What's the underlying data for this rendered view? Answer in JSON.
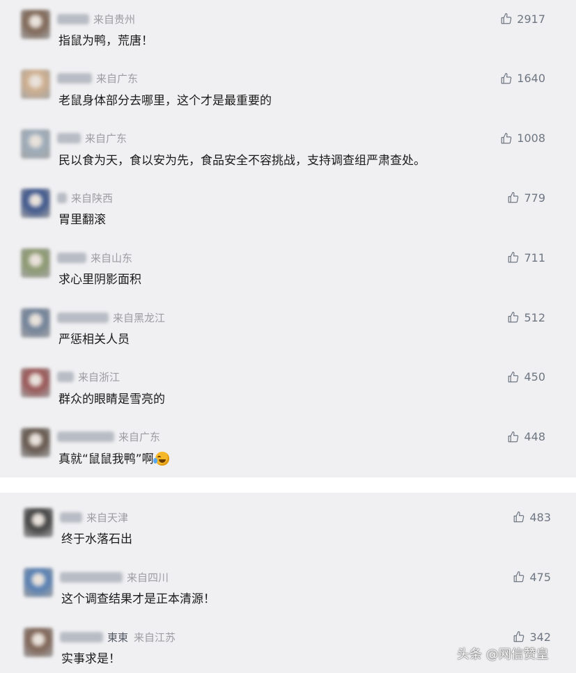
{
  "comments_top": [
    {
      "name_clear": "",
      "location": "来自贵州",
      "text": "指鼠为鸭，荒唐！",
      "likes": "2917",
      "avatar_color": "#6b4e3a"
    },
    {
      "name_clear": "",
      "location": "来自广东",
      "text": "老鼠身体部分去哪里，这个才是最重要的",
      "likes": "1640",
      "avatar_color": "#c9a47e"
    },
    {
      "name_clear": "",
      "location": "来自广东",
      "text": "民以食为天，食以安为先，食品安全不容挑战，支持调查组严肃查处。",
      "likes": "1008",
      "avatar_color": "#8fa0b0"
    },
    {
      "name_clear": "",
      "location": "来自陕西",
      "text": "胃里翻滚",
      "likes": "779",
      "avatar_color": "#1d3a7a"
    },
    {
      "name_clear": "",
      "location": "来自山东",
      "text": "求心里阴影面积",
      "likes": "711",
      "avatar_color": "#7a8a5a"
    },
    {
      "name_clear": "",
      "location": "来自黑龙江",
      "text": "严惩相关人员",
      "likes": "512",
      "avatar_color": "#5a6e8a"
    },
    {
      "name_clear": "",
      "location": "来自浙江",
      "text": "群众的眼睛是雪亮的",
      "likes": "450",
      "avatar_color": "#8a3a3a"
    },
    {
      "name_clear": "",
      "location": "来自广东",
      "text": "真就“鼠鼠我鸭”啊",
      "likes": "448",
      "avatar_color": "#4a3a2e",
      "emoji": "laugh-cry-emoji"
    }
  ],
  "comments_bottom": [
    {
      "name_clear": "",
      "location": "来自天津",
      "text": "终于水落石出",
      "likes": "483",
      "avatar_color": "#222222"
    },
    {
      "name_clear": "",
      "location": "来自四川",
      "text": "这个调查结果才是正本清源！",
      "likes": "475",
      "avatar_color": "#3a6aa8"
    },
    {
      "name_clear": "東東",
      "location": "来自江苏",
      "text": "实事求是！",
      "likes": "342",
      "avatar_color": "#6a4a3a"
    }
  ],
  "watermark": "头条 @网信赞皇",
  "colors": {
    "panel_bg": "#f0f0f2",
    "meta_text": "#9c9ca2",
    "like_text": "#6e7682"
  },
  "icons": {
    "like": "thumbs-up-icon"
  }
}
